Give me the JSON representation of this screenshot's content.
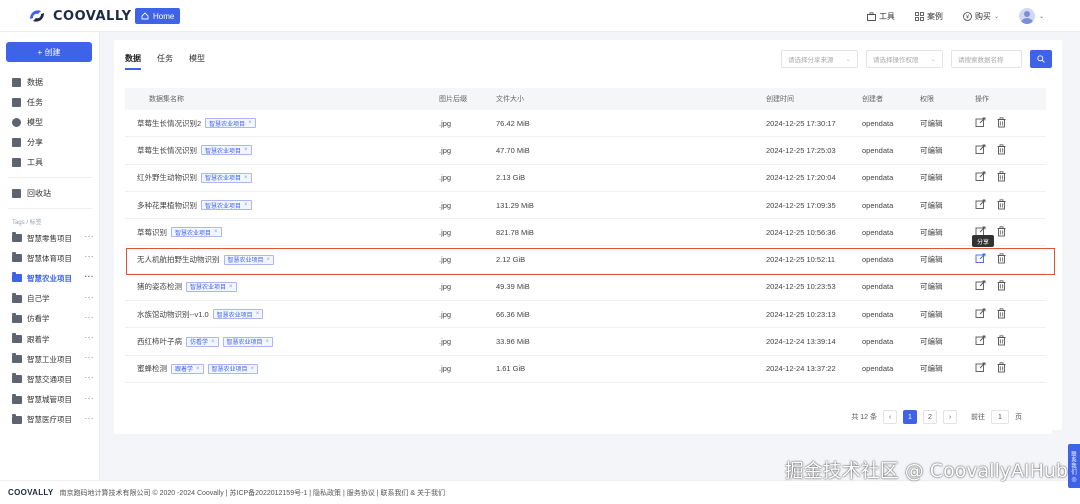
{
  "header": {
    "brand": "COOVALLY",
    "home_label": "Home",
    "tools_label": "工具",
    "cases_label": "案例",
    "buy_label": "购买"
  },
  "sidebar": {
    "create_label": "+ 创建",
    "nav": [
      {
        "label": "数据",
        "icon": "data-icon"
      },
      {
        "label": "任务",
        "icon": "task-icon"
      },
      {
        "label": "模型",
        "icon": "model-icon"
      },
      {
        "label": "分享",
        "icon": "share-icon"
      },
      {
        "label": "工具",
        "icon": "tools-icon"
      }
    ],
    "trash_label": "回收站",
    "tags_title": "Tags / 标签",
    "tags": [
      {
        "label": "智慧零售项目",
        "active": false
      },
      {
        "label": "智慧体育项目",
        "active": false
      },
      {
        "label": "智慧农业项目",
        "active": true
      },
      {
        "label": "自己学",
        "active": false
      },
      {
        "label": "仿看学",
        "active": false
      },
      {
        "label": "跟着学",
        "active": false
      },
      {
        "label": "智慧工业项目",
        "active": false
      },
      {
        "label": "智慧交通项目",
        "active": false
      },
      {
        "label": "智慧城管项目",
        "active": false
      },
      {
        "label": "智慧医疗项目",
        "active": false
      }
    ]
  },
  "main": {
    "tabs": [
      {
        "label": "数据",
        "active": true
      },
      {
        "label": "任务",
        "active": false
      },
      {
        "label": "模型",
        "active": false
      }
    ],
    "filters": {
      "source_placeholder": "请选择分享来源",
      "perm_placeholder": "请选择操作权限",
      "search_placeholder": "请搜索数据名称"
    },
    "columns": {
      "name": "数据集名称",
      "format": "图片后缀",
      "size": "文件大小",
      "time": "创建时间",
      "owner": "创建者",
      "perm": "权限",
      "op": "操作"
    },
    "rows": [
      {
        "name": "草莓生长情况识别2",
        "tags": [
          "智慧农业项目"
        ],
        "format": ".jpg",
        "size": "76.42 MiB",
        "time": "2024-12-25 17:30:17",
        "owner": "opendata",
        "perm": "可编辑"
      },
      {
        "name": "草莓生长情况识别",
        "tags": [
          "智慧农业项目"
        ],
        "format": ".jpg",
        "size": "47.70 MiB",
        "time": "2024-12-25 17:25:03",
        "owner": "opendata",
        "perm": "可编辑"
      },
      {
        "name": "红外野生动物识别",
        "tags": [
          "智慧农业项目"
        ],
        "format": ".jpg",
        "size": "2.13 GiB",
        "time": "2024-12-25 17:20:04",
        "owner": "opendata",
        "perm": "可编辑"
      },
      {
        "name": "多种花果植物识别",
        "tags": [
          "智慧农业项目"
        ],
        "format": ".jpg",
        "size": "131.29 MiB",
        "time": "2024-12-25 17:09:35",
        "owner": "opendata",
        "perm": "可编辑"
      },
      {
        "name": "草莓识别",
        "tags": [
          "智慧农业项目"
        ],
        "format": ".jpg",
        "size": "821.78 MiB",
        "time": "2024-12-25 10:56:36",
        "owner": "opendata",
        "perm": "可编辑"
      },
      {
        "name": "无人机航拍野生动物识别",
        "tags": [
          "智慧农业项目"
        ],
        "format": ".jpg",
        "size": "2.12 GiB",
        "time": "2024-12-25 10:52:11",
        "owner": "opendata",
        "perm": "可编辑"
      },
      {
        "name": "猪的姿态检测",
        "tags": [
          "智慧农业项目"
        ],
        "format": ".jpg",
        "size": "49.39 MiB",
        "time": "2024-12-25 10:23:53",
        "owner": "opendata",
        "perm": "可编辑"
      },
      {
        "name": "水族馆动物识别--v1.0",
        "tags": [
          "智慧农业项目"
        ],
        "format": ".jpg",
        "size": "66.36 MiB",
        "time": "2024-12-25 10:23:13",
        "owner": "opendata",
        "perm": "可编辑"
      },
      {
        "name": "西红柿叶子病",
        "tags": [
          "仿看学",
          "智慧农业项目"
        ],
        "format": ".jpg",
        "size": "33.96 MiB",
        "time": "2024-12-24 13:39:14",
        "owner": "opendata",
        "perm": "可编辑"
      },
      {
        "name": "蜜蜂检测",
        "tags": [
          "跟着学",
          "智慧农业项目"
        ],
        "format": ".jpg",
        "size": "1.61 GiB",
        "time": "2024-12-24 13:37:22",
        "owner": "opendata",
        "perm": "可编辑"
      }
    ],
    "tooltip": "分享"
  },
  "pagination": {
    "total": "共 12 条",
    "pages": [
      "1",
      "2"
    ],
    "current": "1",
    "goto_label": "前往",
    "goto_value": "1",
    "page_suffix": "页"
  },
  "footer": {
    "brand": "COOVALLY",
    "text": "南京跑码地计算技术有限公司 © 2020 -2024 Coovally | 苏ICP备2022012159号-1 | 隐私政策 | 服务协议 | 联系我们 & 关于我们"
  },
  "contact_tab": [
    "联",
    "系",
    "我",
    "们"
  ],
  "watermark": "掘金技术社区 @ CoovallyAIHub",
  "colors": {
    "accent": "#3f63e8",
    "highlight": "#e2542f"
  }
}
